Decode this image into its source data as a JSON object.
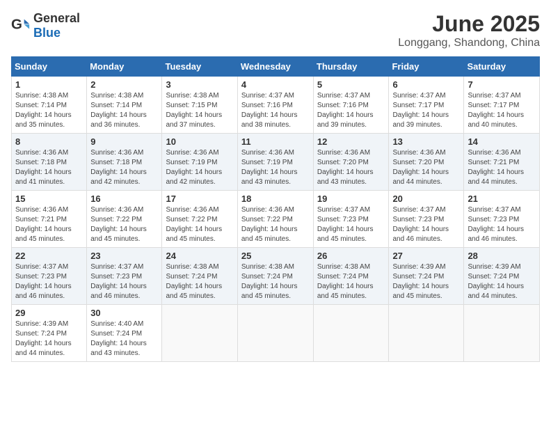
{
  "header": {
    "logo_general": "General",
    "logo_blue": "Blue",
    "month_year": "June 2025",
    "location": "Longgang, Shandong, China"
  },
  "weekdays": [
    "Sunday",
    "Monday",
    "Tuesday",
    "Wednesday",
    "Thursday",
    "Friday",
    "Saturday"
  ],
  "weeks": [
    [
      {
        "day": "1",
        "sunrise": "Sunrise: 4:38 AM",
        "sunset": "Sunset: 7:14 PM",
        "daylight": "Daylight: 14 hours and 35 minutes."
      },
      {
        "day": "2",
        "sunrise": "Sunrise: 4:38 AM",
        "sunset": "Sunset: 7:14 PM",
        "daylight": "Daylight: 14 hours and 36 minutes."
      },
      {
        "day": "3",
        "sunrise": "Sunrise: 4:38 AM",
        "sunset": "Sunset: 7:15 PM",
        "daylight": "Daylight: 14 hours and 37 minutes."
      },
      {
        "day": "4",
        "sunrise": "Sunrise: 4:37 AM",
        "sunset": "Sunset: 7:16 PM",
        "daylight": "Daylight: 14 hours and 38 minutes."
      },
      {
        "day": "5",
        "sunrise": "Sunrise: 4:37 AM",
        "sunset": "Sunset: 7:16 PM",
        "daylight": "Daylight: 14 hours and 39 minutes."
      },
      {
        "day": "6",
        "sunrise": "Sunrise: 4:37 AM",
        "sunset": "Sunset: 7:17 PM",
        "daylight": "Daylight: 14 hours and 39 minutes."
      },
      {
        "day": "7",
        "sunrise": "Sunrise: 4:37 AM",
        "sunset": "Sunset: 7:17 PM",
        "daylight": "Daylight: 14 hours and 40 minutes."
      }
    ],
    [
      {
        "day": "8",
        "sunrise": "Sunrise: 4:36 AM",
        "sunset": "Sunset: 7:18 PM",
        "daylight": "Daylight: 14 hours and 41 minutes."
      },
      {
        "day": "9",
        "sunrise": "Sunrise: 4:36 AM",
        "sunset": "Sunset: 7:18 PM",
        "daylight": "Daylight: 14 hours and 42 minutes."
      },
      {
        "day": "10",
        "sunrise": "Sunrise: 4:36 AM",
        "sunset": "Sunset: 7:19 PM",
        "daylight": "Daylight: 14 hours and 42 minutes."
      },
      {
        "day": "11",
        "sunrise": "Sunrise: 4:36 AM",
        "sunset": "Sunset: 7:19 PM",
        "daylight": "Daylight: 14 hours and 43 minutes."
      },
      {
        "day": "12",
        "sunrise": "Sunrise: 4:36 AM",
        "sunset": "Sunset: 7:20 PM",
        "daylight": "Daylight: 14 hours and 43 minutes."
      },
      {
        "day": "13",
        "sunrise": "Sunrise: 4:36 AM",
        "sunset": "Sunset: 7:20 PM",
        "daylight": "Daylight: 14 hours and 44 minutes."
      },
      {
        "day": "14",
        "sunrise": "Sunrise: 4:36 AM",
        "sunset": "Sunset: 7:21 PM",
        "daylight": "Daylight: 14 hours and 44 minutes."
      }
    ],
    [
      {
        "day": "15",
        "sunrise": "Sunrise: 4:36 AM",
        "sunset": "Sunset: 7:21 PM",
        "daylight": "Daylight: 14 hours and 45 minutes."
      },
      {
        "day": "16",
        "sunrise": "Sunrise: 4:36 AM",
        "sunset": "Sunset: 7:22 PM",
        "daylight": "Daylight: 14 hours and 45 minutes."
      },
      {
        "day": "17",
        "sunrise": "Sunrise: 4:36 AM",
        "sunset": "Sunset: 7:22 PM",
        "daylight": "Daylight: 14 hours and 45 minutes."
      },
      {
        "day": "18",
        "sunrise": "Sunrise: 4:36 AM",
        "sunset": "Sunset: 7:22 PM",
        "daylight": "Daylight: 14 hours and 45 minutes."
      },
      {
        "day": "19",
        "sunrise": "Sunrise: 4:37 AM",
        "sunset": "Sunset: 7:23 PM",
        "daylight": "Daylight: 14 hours and 45 minutes."
      },
      {
        "day": "20",
        "sunrise": "Sunrise: 4:37 AM",
        "sunset": "Sunset: 7:23 PM",
        "daylight": "Daylight: 14 hours and 46 minutes."
      },
      {
        "day": "21",
        "sunrise": "Sunrise: 4:37 AM",
        "sunset": "Sunset: 7:23 PM",
        "daylight": "Daylight: 14 hours and 46 minutes."
      }
    ],
    [
      {
        "day": "22",
        "sunrise": "Sunrise: 4:37 AM",
        "sunset": "Sunset: 7:23 PM",
        "daylight": "Daylight: 14 hours and 46 minutes."
      },
      {
        "day": "23",
        "sunrise": "Sunrise: 4:37 AM",
        "sunset": "Sunset: 7:23 PM",
        "daylight": "Daylight: 14 hours and 46 minutes."
      },
      {
        "day": "24",
        "sunrise": "Sunrise: 4:38 AM",
        "sunset": "Sunset: 7:24 PM",
        "daylight": "Daylight: 14 hours and 45 minutes."
      },
      {
        "day": "25",
        "sunrise": "Sunrise: 4:38 AM",
        "sunset": "Sunset: 7:24 PM",
        "daylight": "Daylight: 14 hours and 45 minutes."
      },
      {
        "day": "26",
        "sunrise": "Sunrise: 4:38 AM",
        "sunset": "Sunset: 7:24 PM",
        "daylight": "Daylight: 14 hours and 45 minutes."
      },
      {
        "day": "27",
        "sunrise": "Sunrise: 4:39 AM",
        "sunset": "Sunset: 7:24 PM",
        "daylight": "Daylight: 14 hours and 45 minutes."
      },
      {
        "day": "28",
        "sunrise": "Sunrise: 4:39 AM",
        "sunset": "Sunset: 7:24 PM",
        "daylight": "Daylight: 14 hours and 44 minutes."
      }
    ],
    [
      {
        "day": "29",
        "sunrise": "Sunrise: 4:39 AM",
        "sunset": "Sunset: 7:24 PM",
        "daylight": "Daylight: 14 hours and 44 minutes."
      },
      {
        "day": "30",
        "sunrise": "Sunrise: 4:40 AM",
        "sunset": "Sunset: 7:24 PM",
        "daylight": "Daylight: 14 hours and 43 minutes."
      },
      null,
      null,
      null,
      null,
      null
    ]
  ]
}
